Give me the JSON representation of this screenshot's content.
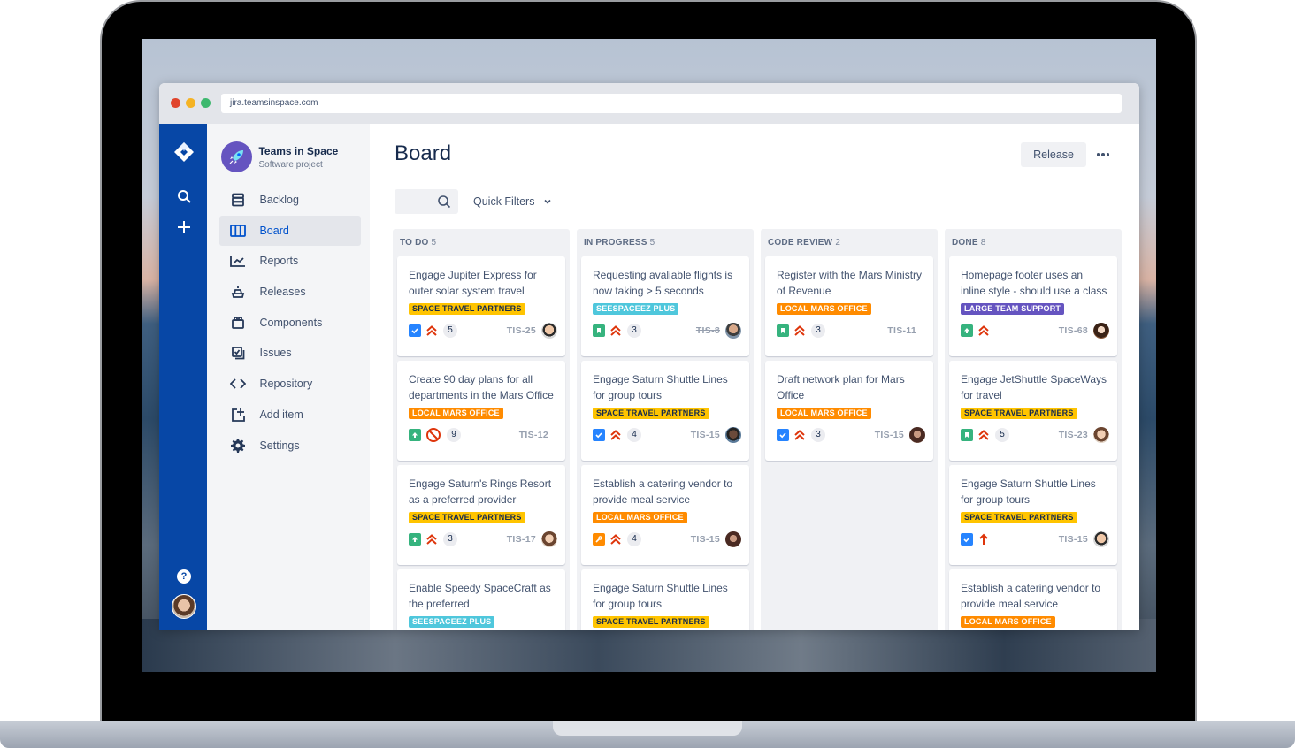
{
  "browser": {
    "url": "jira.teamsinspace.com"
  },
  "global_nav": {
    "logo": "jira-logo-icon",
    "items": [
      {
        "name": "search",
        "icon": "search-icon"
      },
      {
        "name": "create",
        "icon": "plus-icon"
      }
    ],
    "help_label": "?",
    "avatar": "user-avatar"
  },
  "sidebar": {
    "project_name": "Teams in Space",
    "project_type": "Software project",
    "items": [
      {
        "label": "Backlog",
        "icon": "backlog-icon",
        "active": false
      },
      {
        "label": "Board",
        "icon": "board-icon",
        "active": true
      },
      {
        "label": "Reports",
        "icon": "reports-icon",
        "active": false
      },
      {
        "label": "Releases",
        "icon": "releases-icon",
        "active": false
      },
      {
        "label": "Components",
        "icon": "components-icon",
        "active": false
      },
      {
        "label": "Issues",
        "icon": "issues-icon",
        "active": false
      },
      {
        "label": "Repository",
        "icon": "code-icon",
        "active": false
      },
      {
        "label": "Add item",
        "icon": "add-item-icon",
        "active": false
      },
      {
        "label": "Settings",
        "icon": "gear-icon",
        "active": false
      }
    ]
  },
  "main": {
    "title": "Board",
    "release_label": "Release",
    "more_icon": "more-icon",
    "search_placeholder": "",
    "quick_filters_label": "Quick Filters"
  },
  "colors": {
    "brand_nav": "#0747a6",
    "active_text": "#0052cc",
    "label_space_travel": "#ffc400",
    "label_local_mars": "#ff8b00",
    "label_seespaceez": "#4fc7dc",
    "label_large_team": "#6554c0",
    "type_task": "#2684ff",
    "type_story": "#36b37e",
    "type_improvement": "#36b37e",
    "type_bug_fix": "#ff8b00",
    "priority": "#de350b"
  },
  "columns": [
    {
      "title": "TO DO",
      "count": "5",
      "cards": [
        {
          "title": "Engage Jupiter Express for outer solar system travel",
          "label": "SPACE TRAVEL PARTNERS",
          "label_kind": "space",
          "type": "task",
          "priority": "highest",
          "points": "5",
          "key": "TIS-25",
          "done": false,
          "assignee": "a1"
        },
        {
          "title": "Create 90 day plans for all departments in the Mars Office",
          "label": "LOCAL MARS OFFICE",
          "label_kind": "mars",
          "type": "improvement",
          "priority": "blocker",
          "points": "9",
          "key": "TIS-12",
          "done": false,
          "assignee": ""
        },
        {
          "title": "Engage Saturn's Rings Resort as a preferred provider",
          "label": "SPACE TRAVEL PARTNERS",
          "label_kind": "space",
          "type": "improvement",
          "priority": "highest",
          "points": "3",
          "key": "TIS-17",
          "done": false,
          "assignee": "a2"
        },
        {
          "title": "Enable Speedy SpaceCraft as the preferred",
          "label": "SEESPACEEZ PLUS",
          "label_kind": "seespaceez",
          "type": "",
          "priority": "",
          "points": "",
          "key": "",
          "done": false,
          "assignee": ""
        }
      ]
    },
    {
      "title": "IN PROGRESS",
      "count": "5",
      "cards": [
        {
          "title": "Requesting avaliable flights is now taking > 5 seconds",
          "label": "SEESPACEEZ PLUS",
          "label_kind": "seespaceez",
          "type": "story",
          "priority": "highest",
          "points": "3",
          "key": "TIS-8",
          "done": true,
          "assignee": "a3"
        },
        {
          "title": "Engage Saturn Shuttle Lines for group tours",
          "label": "SPACE TRAVEL PARTNERS",
          "label_kind": "space",
          "type": "task",
          "priority": "highest",
          "points": "4",
          "key": "TIS-15",
          "done": false,
          "assignee": "a4"
        },
        {
          "title": "Establish a catering vendor to provide meal service",
          "label": "LOCAL MARS OFFICE",
          "label_kind": "mars",
          "type": "bugfix",
          "priority": "highest",
          "points": "4",
          "key": "TIS-15",
          "done": false,
          "assignee": "a5"
        },
        {
          "title": "Engage Saturn Shuttle Lines for group tours",
          "label": "SPACE TRAVEL PARTNERS",
          "label_kind": "space",
          "type": "",
          "priority": "",
          "points": "",
          "key": "",
          "done": false,
          "assignee": ""
        }
      ]
    },
    {
      "title": "CODE REVIEW",
      "count": "2",
      "cards": [
        {
          "title": "Register with the Mars Ministry of Revenue",
          "label": "LOCAL MARS OFFICE",
          "label_kind": "mars",
          "type": "story",
          "priority": "highest",
          "points": "3",
          "key": "TIS-11",
          "done": false,
          "assignee": ""
        },
        {
          "title": "Draft network plan for Mars Office",
          "label": "LOCAL MARS OFFICE",
          "label_kind": "mars",
          "type": "task",
          "priority": "highest",
          "points": "3",
          "key": "TIS-15",
          "done": false,
          "assignee": "a5"
        }
      ]
    },
    {
      "title": "DONE",
      "count": "8",
      "cards": [
        {
          "title": "Homepage footer uses an inline style - should use a class",
          "label": "LARGE TEAM SUPPORT",
          "label_kind": "large",
          "type": "improvement",
          "priority": "highest",
          "points": "",
          "key": "TIS-68",
          "done": false,
          "assignee": "a6"
        },
        {
          "title": "Engage JetShuttle SpaceWays for travel",
          "label": "SPACE TRAVEL PARTNERS",
          "label_kind": "space",
          "type": "story",
          "priority": "highest",
          "points": "5",
          "key": "TIS-23",
          "done": false,
          "assignee": "a2"
        },
        {
          "title": "Engage Saturn Shuttle Lines for group tours",
          "label": "SPACE TRAVEL PARTNERS",
          "label_kind": "space",
          "type": "task",
          "priority": "high",
          "points": "",
          "key": "TIS-15",
          "done": false,
          "assignee": "a1"
        },
        {
          "title": "Establish a catering vendor to provide meal service",
          "label": "LOCAL MARS OFFICE",
          "label_kind": "mars",
          "type": "",
          "priority": "",
          "points": "",
          "key": "",
          "done": false,
          "assignee": ""
        }
      ]
    }
  ]
}
